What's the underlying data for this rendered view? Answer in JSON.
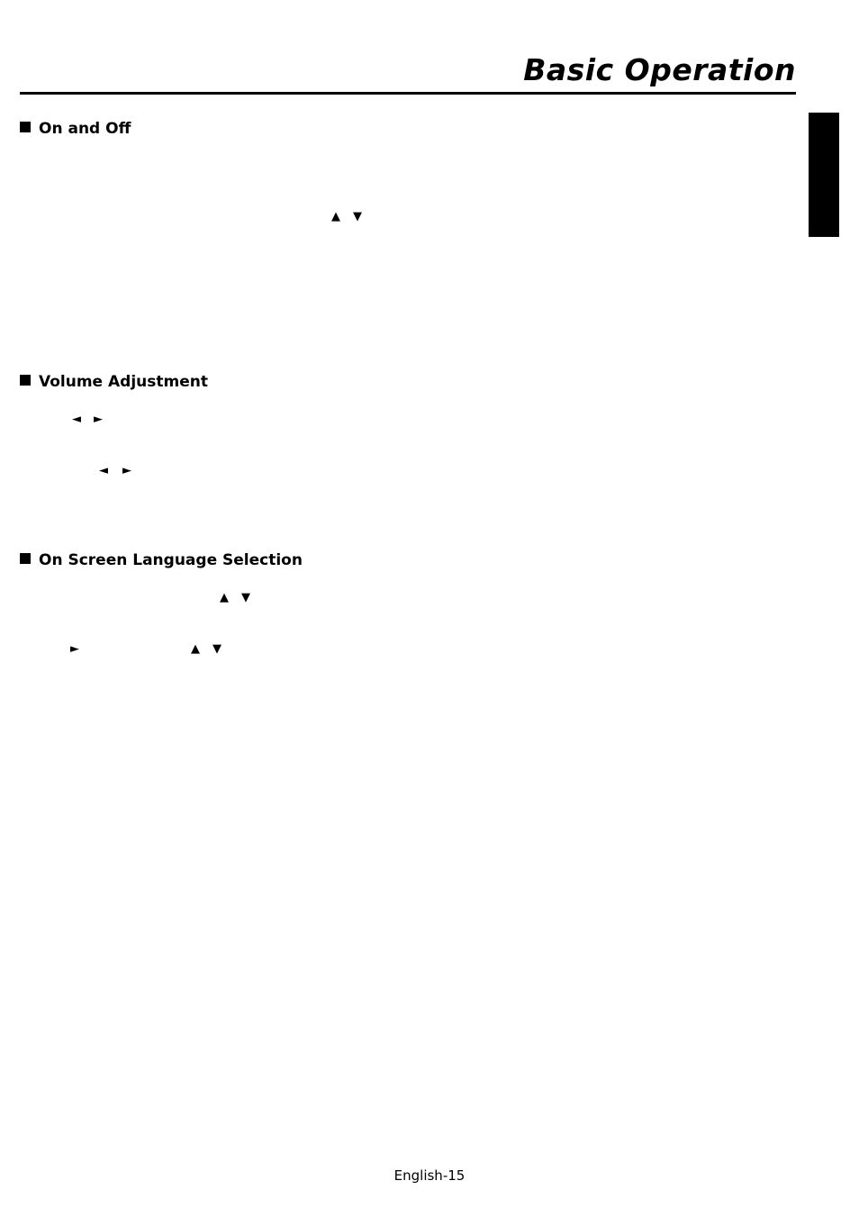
{
  "header": {
    "title": "Basic Operation"
  },
  "sections": [
    {
      "label": "On and Off"
    },
    {
      "label": "Volume Adjustment"
    },
    {
      "label": "On Screen Language Selection"
    }
  ],
  "glyphs": {
    "up": "▲",
    "down": "▼",
    "left": "◄",
    "right": "►"
  },
  "footer": {
    "page_label": "English-15"
  }
}
